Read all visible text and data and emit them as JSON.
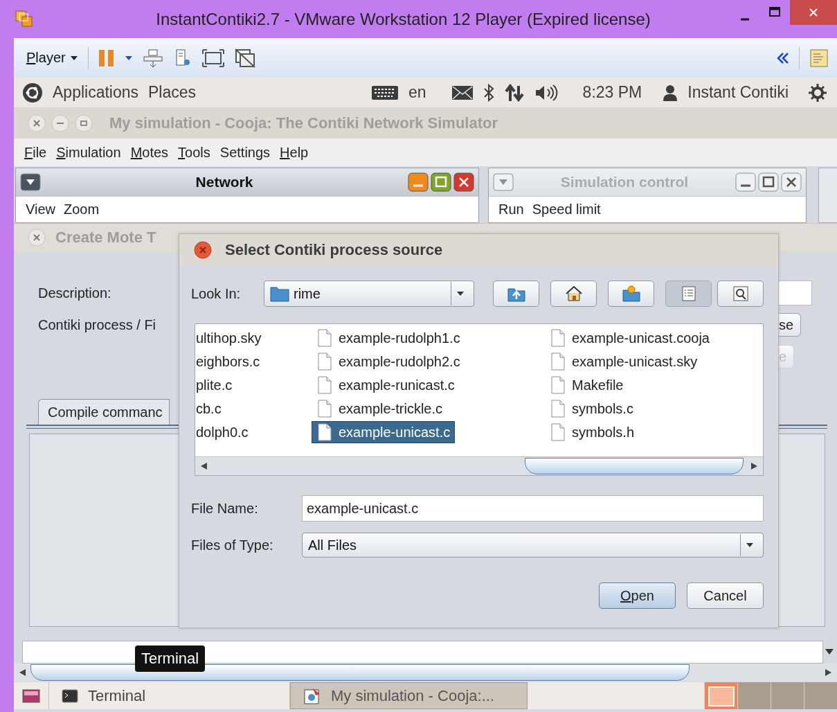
{
  "window": {
    "title": "InstantContiki2.7 - VMware Workstation 12 Player (Expired license)"
  },
  "toolbar": {
    "player_menu": {
      "label": "Player",
      "mnemonic": true
    }
  },
  "top_panel": {
    "menus": [
      "Applications",
      "Places"
    ],
    "keyboard": "en",
    "clock": "8:23 PM",
    "user": "Instant Contiki"
  },
  "app_window": {
    "title": "My simulation - Cooja: The Contiki Network Simulator",
    "menu": [
      {
        "label": "File",
        "mnemonic": true
      },
      {
        "label": "Simulation",
        "mnemonic": true
      },
      {
        "label": "Motes",
        "mnemonic": true
      },
      {
        "label": "Tools",
        "mnemonic": true
      },
      {
        "label": "Settings",
        "mnemonic": false
      },
      {
        "label": "Help",
        "mnemonic": true
      }
    ]
  },
  "internal_frames": [
    {
      "title": "Network",
      "active": true,
      "menu": [
        "View",
        "Zoom"
      ]
    },
    {
      "title": "Simulation control",
      "active": false,
      "menu": [
        "Run",
        "Speed limit"
      ]
    }
  ],
  "create_mote_dialog": {
    "title": "Create Mote T",
    "labels": [
      "Description:",
      "Contiki process / Fi"
    ],
    "tab": "Compile commanc",
    "buttons": [
      {
        "label": "se",
        "disabled": false
      },
      {
        "label": "e",
        "disabled": true
      }
    ]
  },
  "file_dialog": {
    "title": "Select Contiki process source",
    "look_in_label": "Look In:",
    "look_in": "rime",
    "tool_buttons": [
      {
        "kind": "up",
        "selected": false
      },
      {
        "kind": "home",
        "selected": false
      },
      {
        "kind": "new-folder",
        "selected": false
      },
      {
        "kind": "list",
        "selected": true
      },
      {
        "kind": "details",
        "selected": false
      }
    ],
    "columns": [
      {
        "clipped": true,
        "files": [
          {
            "name": "ultihop.sky",
            "selected": false
          },
          {
            "name": "eighbors.c",
            "selected": false
          },
          {
            "name": "plite.c",
            "selected": false
          },
          {
            "name": "cb.c",
            "selected": false
          },
          {
            "name": "dolph0.c",
            "selected": false
          }
        ]
      },
      {
        "clipped": false,
        "files": [
          {
            "name": "example-rudolph1.c",
            "selected": false
          },
          {
            "name": "example-rudolph2.c",
            "selected": false
          },
          {
            "name": "example-runicast.c",
            "selected": false
          },
          {
            "name": "example-trickle.c",
            "selected": false
          },
          {
            "name": "example-unicast.c",
            "selected": true
          }
        ]
      },
      {
        "clipped": false,
        "files": [
          {
            "name": "example-unicast.cooja",
            "selected": false
          },
          {
            "name": "example-unicast.sky",
            "selected": false
          },
          {
            "name": "Makefile",
            "selected": false
          },
          {
            "name": "symbols.c",
            "selected": false
          },
          {
            "name": "symbols.h",
            "selected": false
          }
        ]
      }
    ],
    "file_name_label": "File Name:",
    "file_name": "example-unicast.c",
    "type_label": "Files of Type:",
    "type": "All Files",
    "buttons": [
      {
        "label": "Open",
        "mnemonic": true,
        "default": true
      },
      {
        "label": "Cancel",
        "mnemonic": false,
        "default": false
      }
    ]
  },
  "tooltip": "Terminal",
  "taskbar": {
    "items": [
      {
        "label": "Terminal",
        "kind": "terminal",
        "selected": false
      },
      {
        "label": "My simulation - Cooja:...",
        "kind": "cooja",
        "selected": true
      }
    ],
    "workspaces": [
      {
        "selected": true
      },
      {
        "selected": false
      },
      {
        "selected": false
      },
      {
        "selected": false
      }
    ]
  }
}
